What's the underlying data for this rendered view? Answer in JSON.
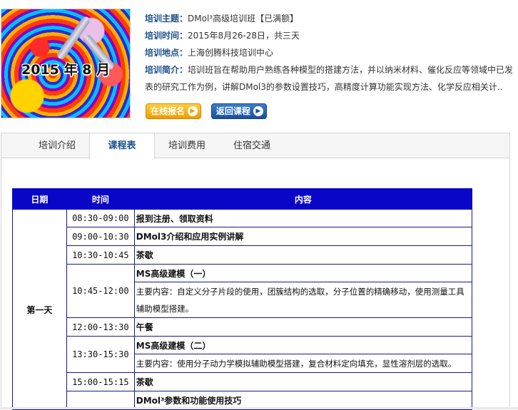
{
  "banner": {
    "year_text": "2015 年 8 月"
  },
  "info": {
    "topic_label": "培训主题：",
    "topic": "DMol³高级培训班【已满额】",
    "time_label": "培训时间：",
    "time": "2015年8月26-28日，共三天",
    "place_label": "培训地点：",
    "place": "上海创腾科技培训中心",
    "intro_label": "培训简介：",
    "intro": "培训班旨在帮助用户熟练各种模型的搭建方法，并以纳米材料、催化反应等领域中已发表的研究工作为例，讲解DMol3的参数设置技巧，高精度计算功能实现方法、化学反应相关计.."
  },
  "buttons": {
    "signup": "在线报名",
    "back": "返回课程"
  },
  "tabs": [
    "培训介绍",
    "课程表",
    "培训费用",
    "住宿交通"
  ],
  "table": {
    "headers": [
      "日期",
      "时间",
      "内容"
    ],
    "day1": "第一天",
    "rows": [
      {
        "time": "08:30-09:00",
        "content": "报到注册、领取资料"
      },
      {
        "time": "09:00-10:30",
        "content": "DMol3介绍和应用实例讲解"
      },
      {
        "time": "10:30-10:45",
        "content": "茶歇"
      },
      {
        "time": "10:45-12:00",
        "content": "MS高级建模（一）",
        "desc": "主要内容：自定义分子片段的使用，团簇结构的选取，分子位置的精确移动，使用测量工具辅助模型搭建。"
      },
      {
        "time": "12:00-13:30",
        "content": "午餐"
      },
      {
        "time": "13:30-15:30",
        "content": "MS高级建模（二）",
        "desc": "主要内容：使用分子动力学模拟辅助模型搭建，复合材料定向填充，显性溶剂层的选取。"
      },
      {
        "time": "15:00-15:15",
        "content": "茶歇"
      },
      {
        "time": "",
        "content": "DMol³参数和功能使用技巧"
      }
    ]
  }
}
